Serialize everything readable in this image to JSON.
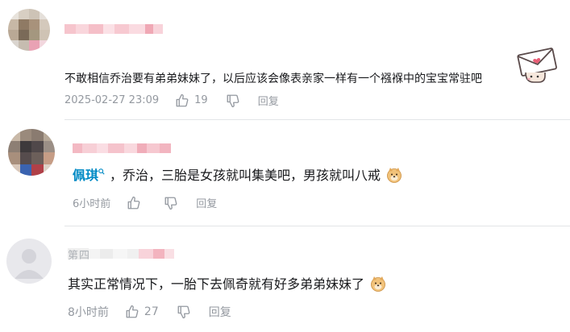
{
  "comments": [
    {
      "id": "c1",
      "username": "",
      "content": "不敢相信乔治要有弟弟妹妹了，以后应该会像表亲家一样有一个襁褓中的宝宝常驻吧",
      "time": "2025-02-27 23:09",
      "like_count": "19",
      "reply_label": "回复",
      "has_sticker": true
    },
    {
      "id": "c2",
      "username": "",
      "mention": "佩琪",
      "content": "，乔治，三胎是女孩就叫集美吧，男孩就叫八戒",
      "time": "6小时前",
      "like_count": "",
      "reply_label": "回复"
    },
    {
      "id": "c3",
      "username": "第四",
      "content": "其实正常情况下，一胎下去佩奇就有好多弟弟妹妹了",
      "time": "8小时前",
      "like_count": "27",
      "reply_label": "回复"
    }
  ],
  "icons": {
    "like": "thumbs-up-icon",
    "dislike": "thumbs-down-icon",
    "emoji": "doge-emoji-icon",
    "sticker": "love-letter-sticker",
    "mention": "search-mention-icon"
  },
  "colors": {
    "mention": "#008ac5",
    "meta": "#9499a0",
    "text": "#18191c",
    "divider": "#e3e5e7",
    "blurred_name": "#f4a7b1"
  }
}
